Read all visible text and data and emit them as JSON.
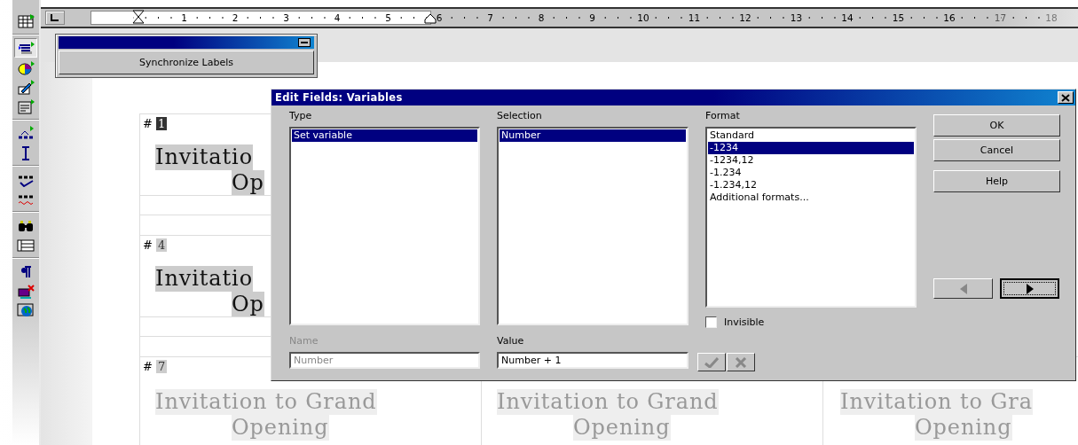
{
  "toolbar": {
    "items": [
      {
        "selected": false
      },
      {
        "selected": true
      },
      {
        "selected": false
      },
      {
        "selected": false
      },
      {
        "selected": false
      },
      {
        "selected": false
      },
      {
        "selected": false
      },
      {
        "selected": false
      },
      {
        "selected": false
      },
      {
        "selected": false
      },
      {
        "selected": false
      },
      {
        "selected": false
      },
      {
        "selected": false
      },
      {
        "selected": false
      }
    ]
  },
  "ruler": {
    "numbers": [
      "1",
      "2",
      "3",
      "4",
      "5",
      "6",
      "7",
      "8",
      "9",
      "10",
      "11",
      "12",
      "13",
      "14",
      "15",
      "16",
      "17",
      "18"
    ]
  },
  "sync_window": {
    "button": "Synchronize Labels"
  },
  "label_rows": [
    {
      "cells": [
        {
          "hash": "#",
          "number": "1",
          "selected": true,
          "line1": "Invitatio",
          "line2": "Op"
        }
      ]
    },
    {
      "cells": [
        {
          "hash": "#",
          "number": "4",
          "selected": false,
          "line1": "Invitatio",
          "line2": "Op"
        }
      ]
    },
    {
      "cells": [
        {
          "hash": "#",
          "number": "7",
          "selected": false,
          "line1": "Invitation to Grand",
          "line2": "Opening"
        },
        {
          "line1": "Invitation to Grand",
          "line2": "Opening"
        },
        {
          "line1": "Invitation to Gra",
          "line2": "Opening"
        }
      ]
    }
  ],
  "dialog": {
    "title": "Edit Fields: Variables",
    "type": {
      "label": "Type",
      "items": [
        {
          "text": "Set variable",
          "selected": true
        }
      ]
    },
    "selection": {
      "label": "Selection",
      "items": [
        {
          "text": "Number",
          "selected": true
        }
      ]
    },
    "format": {
      "label": "Format",
      "items": [
        {
          "text": "Standard",
          "selected": false
        },
        {
          "text": "-1234",
          "selected": true
        },
        {
          "text": "-1234,12",
          "selected": false
        },
        {
          "text": "-1.234",
          "selected": false
        },
        {
          "text": "-1.234,12",
          "selected": false
        },
        {
          "text": "Additional formats...",
          "selected": false
        }
      ]
    },
    "invisible": {
      "label": "Invisible",
      "checked": false
    },
    "name": {
      "label": "Name",
      "value": "Number",
      "disabled": true
    },
    "value": {
      "label": "Value",
      "value": "Number + 1",
      "disabled": false
    },
    "edit_buttons": [
      {
        "kind": "accept",
        "disabled": true
      },
      {
        "kind": "reject",
        "disabled": true
      }
    ],
    "buttons": [
      {
        "label": "OK"
      },
      {
        "label": "Cancel"
      },
      {
        "label": "Help"
      }
    ],
    "nav": [
      {
        "kind": "prev",
        "disabled": true
      },
      {
        "kind": "next",
        "disabled": false
      }
    ]
  }
}
